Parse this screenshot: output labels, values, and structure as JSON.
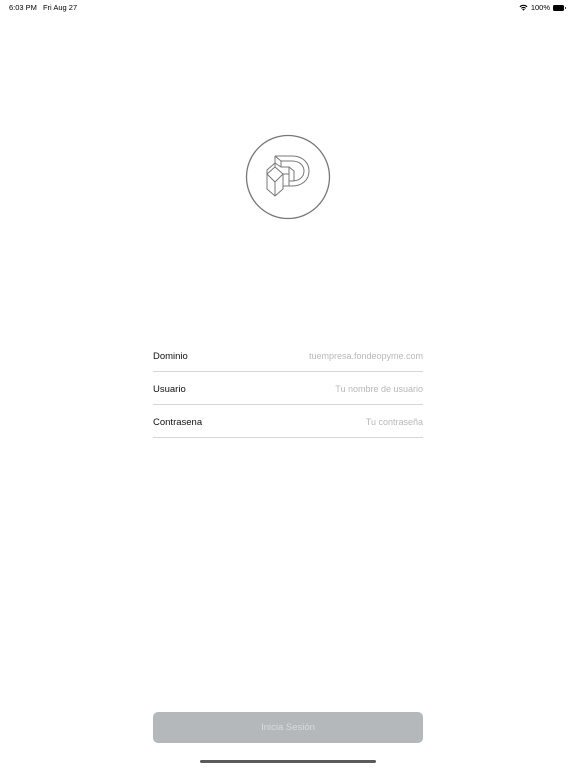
{
  "status_bar": {
    "time": "6:03 PM",
    "date": "Fri Aug 27",
    "battery": "100%"
  },
  "form": {
    "domain": {
      "label": "Dominio",
      "placeholder": "tuempresa.fondeopyme.com",
      "value": ""
    },
    "user": {
      "label": "Usuario",
      "placeholder": "Tu nombre de usuario",
      "value": ""
    },
    "password": {
      "label": "Contrasena",
      "placeholder": "Tu contraseña",
      "value": ""
    }
  },
  "login_button": {
    "label": "Inicia Sesión"
  },
  "colors": {
    "button_bg": "#b5b8ba",
    "button_text": "#d9dbdc",
    "divider": "#d6d6d6",
    "placeholder": "#b8b8b8"
  },
  "icons": {
    "logo": "p-logo-icon",
    "wifi": "wifi-icon",
    "battery": "battery-icon"
  }
}
